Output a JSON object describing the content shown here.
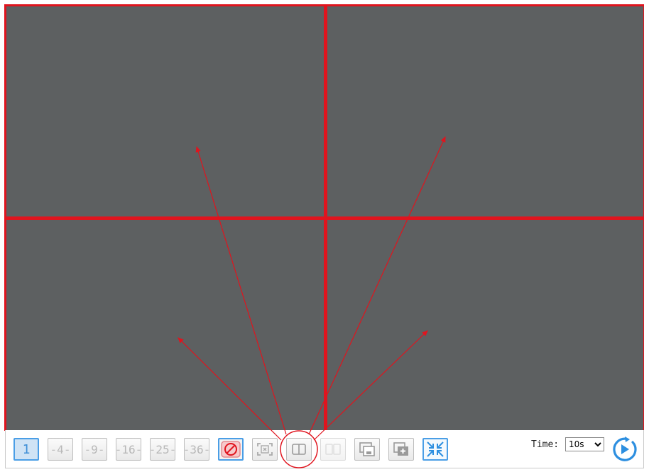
{
  "layout_buttons": [
    {
      "label": "1",
      "state": "active"
    },
    {
      "label": "4",
      "state": "normal"
    },
    {
      "label": "9",
      "state": "normal"
    },
    {
      "label": "16",
      "state": "normal"
    },
    {
      "label": "25",
      "state": "normal"
    },
    {
      "label": "36",
      "state": "normal"
    }
  ],
  "time": {
    "label": "Time:",
    "selected": "10s"
  },
  "colors": {
    "accent": "#4a9ee6",
    "highlight": "#e0141e",
    "pane_bg": "#5d6061"
  },
  "icons": {
    "custom_layout": "no-entry-icon",
    "fullscreen_pane": "fit-to-screen-icon",
    "split_pane": "split-view-icon",
    "dual_pane": "dual-view-icon",
    "window_screen": "window-icon",
    "add_window": "add-window-icon",
    "collapse": "collapse-arrows-icon",
    "play": "play-circle-icon"
  }
}
